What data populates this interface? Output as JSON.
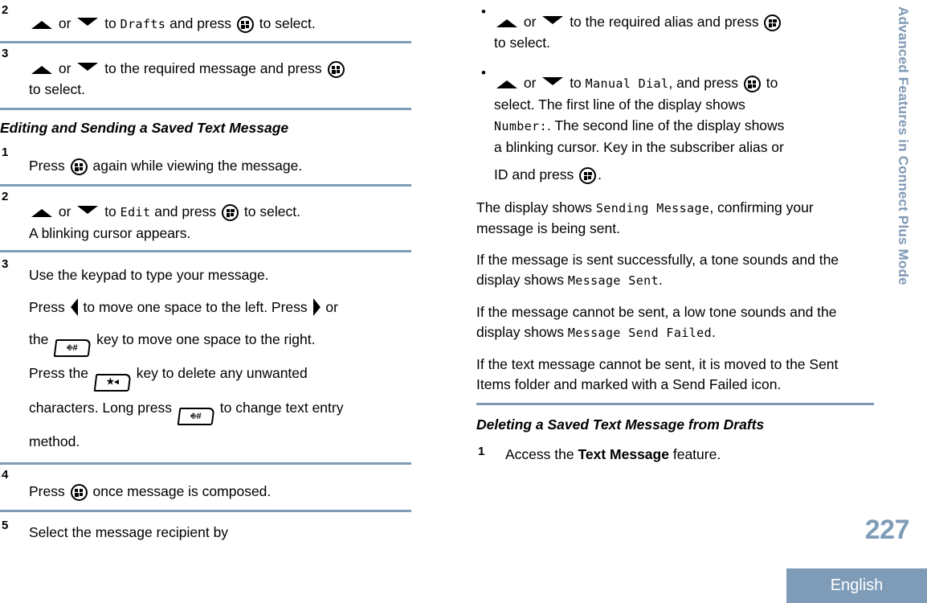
{
  "sidebar": {
    "chapter_title": "Advanced Features in Connect Plus Mode"
  },
  "footer": {
    "page_number": "227",
    "language": "English"
  },
  "colors": {
    "accent": "#7e9bb8",
    "sidebar_text": "#8099b5",
    "rule": "#7e9bb8",
    "text": "#000000"
  },
  "icons": {
    "menu_select": "menu-select-button-icon",
    "up_arrow": "up-arrow-icon",
    "down_arrow": "down-arrow-icon",
    "left_arrow": "left-arrow-icon",
    "right_arrow": "right-arrow-icon",
    "hash_key": "hash-key-icon",
    "star_key": "star-delete-key-icon"
  },
  "left_column": {
    "step_a": {
      "number": "2",
      "t1": "or",
      "t2": "to",
      "value": "Drafts",
      "t3": "and press",
      "t4": "to select."
    },
    "step_b": {
      "number": "3",
      "t1": "or",
      "t2": "to the required message and press",
      "t3": "to select."
    },
    "heading": "Editing and Sending a Saved Text Message",
    "step_1": {
      "number": "1",
      "t1": "Press",
      "t2": "again while viewing the message."
    },
    "step_2": {
      "number": "2",
      "t1": "or",
      "t2": "to",
      "value": "Edit",
      "t3": "and press",
      "t4": "to select.",
      "t5": "A blinking cursor appears."
    },
    "step_3": {
      "number": "3",
      "t1": "Use the keypad to type your message.",
      "t2": "Press",
      "t3": "to move one space to the left. Press",
      "t4": "or",
      "t5": "the",
      "t6": "key to move one space to the right.",
      "t7": "Press the",
      "t8": "key to delete any unwanted",
      "t9": "characters. Long press",
      "t10": "to change text entry",
      "t11": "method."
    },
    "step_4": {
      "number": "4",
      "t1": "Press",
      "t2": "once message is composed."
    },
    "step_5": {
      "number": "5",
      "t1": "Select the message recipient by"
    }
  },
  "right_column": {
    "bullet_1": {
      "marker": "•",
      "t1": "or",
      "t2": "to the required alias and press",
      "t3": "to select."
    },
    "bullet_2": {
      "marker": "•",
      "t1": "or",
      "t2": "to",
      "value1": "Manual Dial",
      "t3": ", and press",
      "t4": "to",
      "t5": "select. The first line of the display shows",
      "value2": "Number:",
      "t6": ". The second line of the display shows",
      "t7": "a blinking cursor. Key in the subscriber alias or",
      "t8": "ID and press",
      "t9": "."
    },
    "para_1": {
      "t1": "The display shows",
      "value": "Sending Message",
      "t2": ", confirming your message is being sent."
    },
    "para_2": {
      "t1": "If the message is sent successfully, a tone sounds and the display shows",
      "value": "Message Sent",
      "t2": "."
    },
    "para_3": {
      "t1": "If the message cannot be sent, a low tone sounds and the display shows",
      "value": "Message Send Failed",
      "t2": "."
    },
    "para_4": {
      "t1": "If the text message cannot be sent, it is moved to the Sent Items folder and marked with a Send Failed icon."
    },
    "heading": "Deleting a Saved Text Message from Drafts",
    "step_1": {
      "number": "1",
      "t1": "Access the",
      "bold": "Text Message",
      "t2": "feature."
    }
  },
  "key_glyphs": {
    "hash": "#",
    "star": "★",
    "backspace": "⊲",
    "shift": "⎇"
  }
}
